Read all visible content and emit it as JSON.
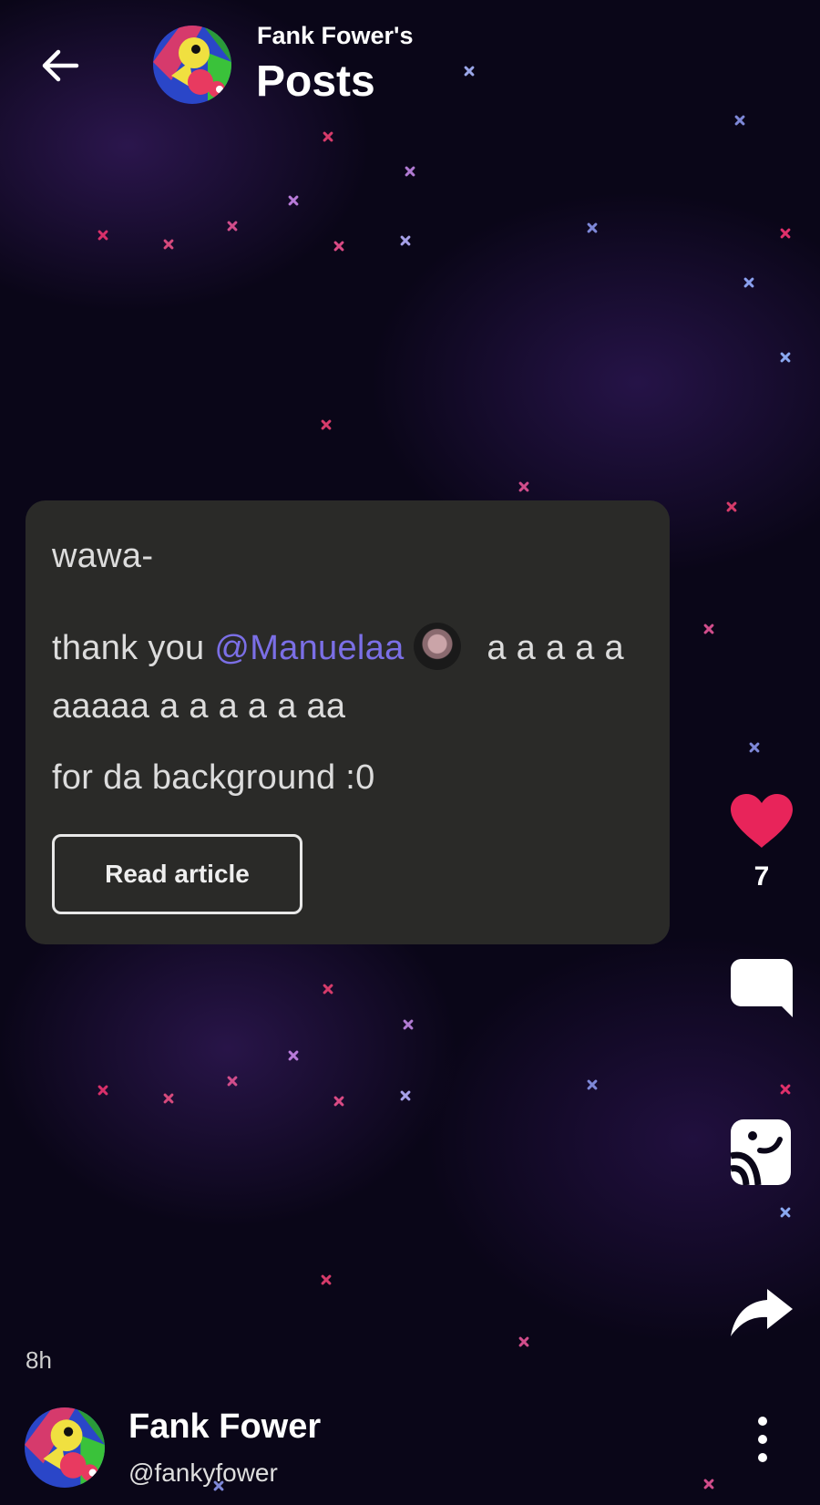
{
  "header": {
    "subtitle": "Fank Fower's",
    "title": "Posts"
  },
  "post": {
    "line1": "wawa-",
    "line2_prefix": "thank you ",
    "mention": "@Manuelaa",
    "line2_suffix": " a a a a a aaaaa a a a a a  aa",
    "line3": "for da background :0",
    "read_button": "Read article"
  },
  "actions": {
    "like_count": "7",
    "icons": [
      "heart-icon",
      "comment-icon",
      "save-icon",
      "share-icon"
    ]
  },
  "footer": {
    "time_ago": "8h",
    "author_name": "Fank Fower",
    "author_handle": "@fankyfower"
  },
  "colors": {
    "background": "#0a0618",
    "card": "#2a2a28",
    "mention": "#7b6fe6",
    "like": "#e8245a"
  }
}
